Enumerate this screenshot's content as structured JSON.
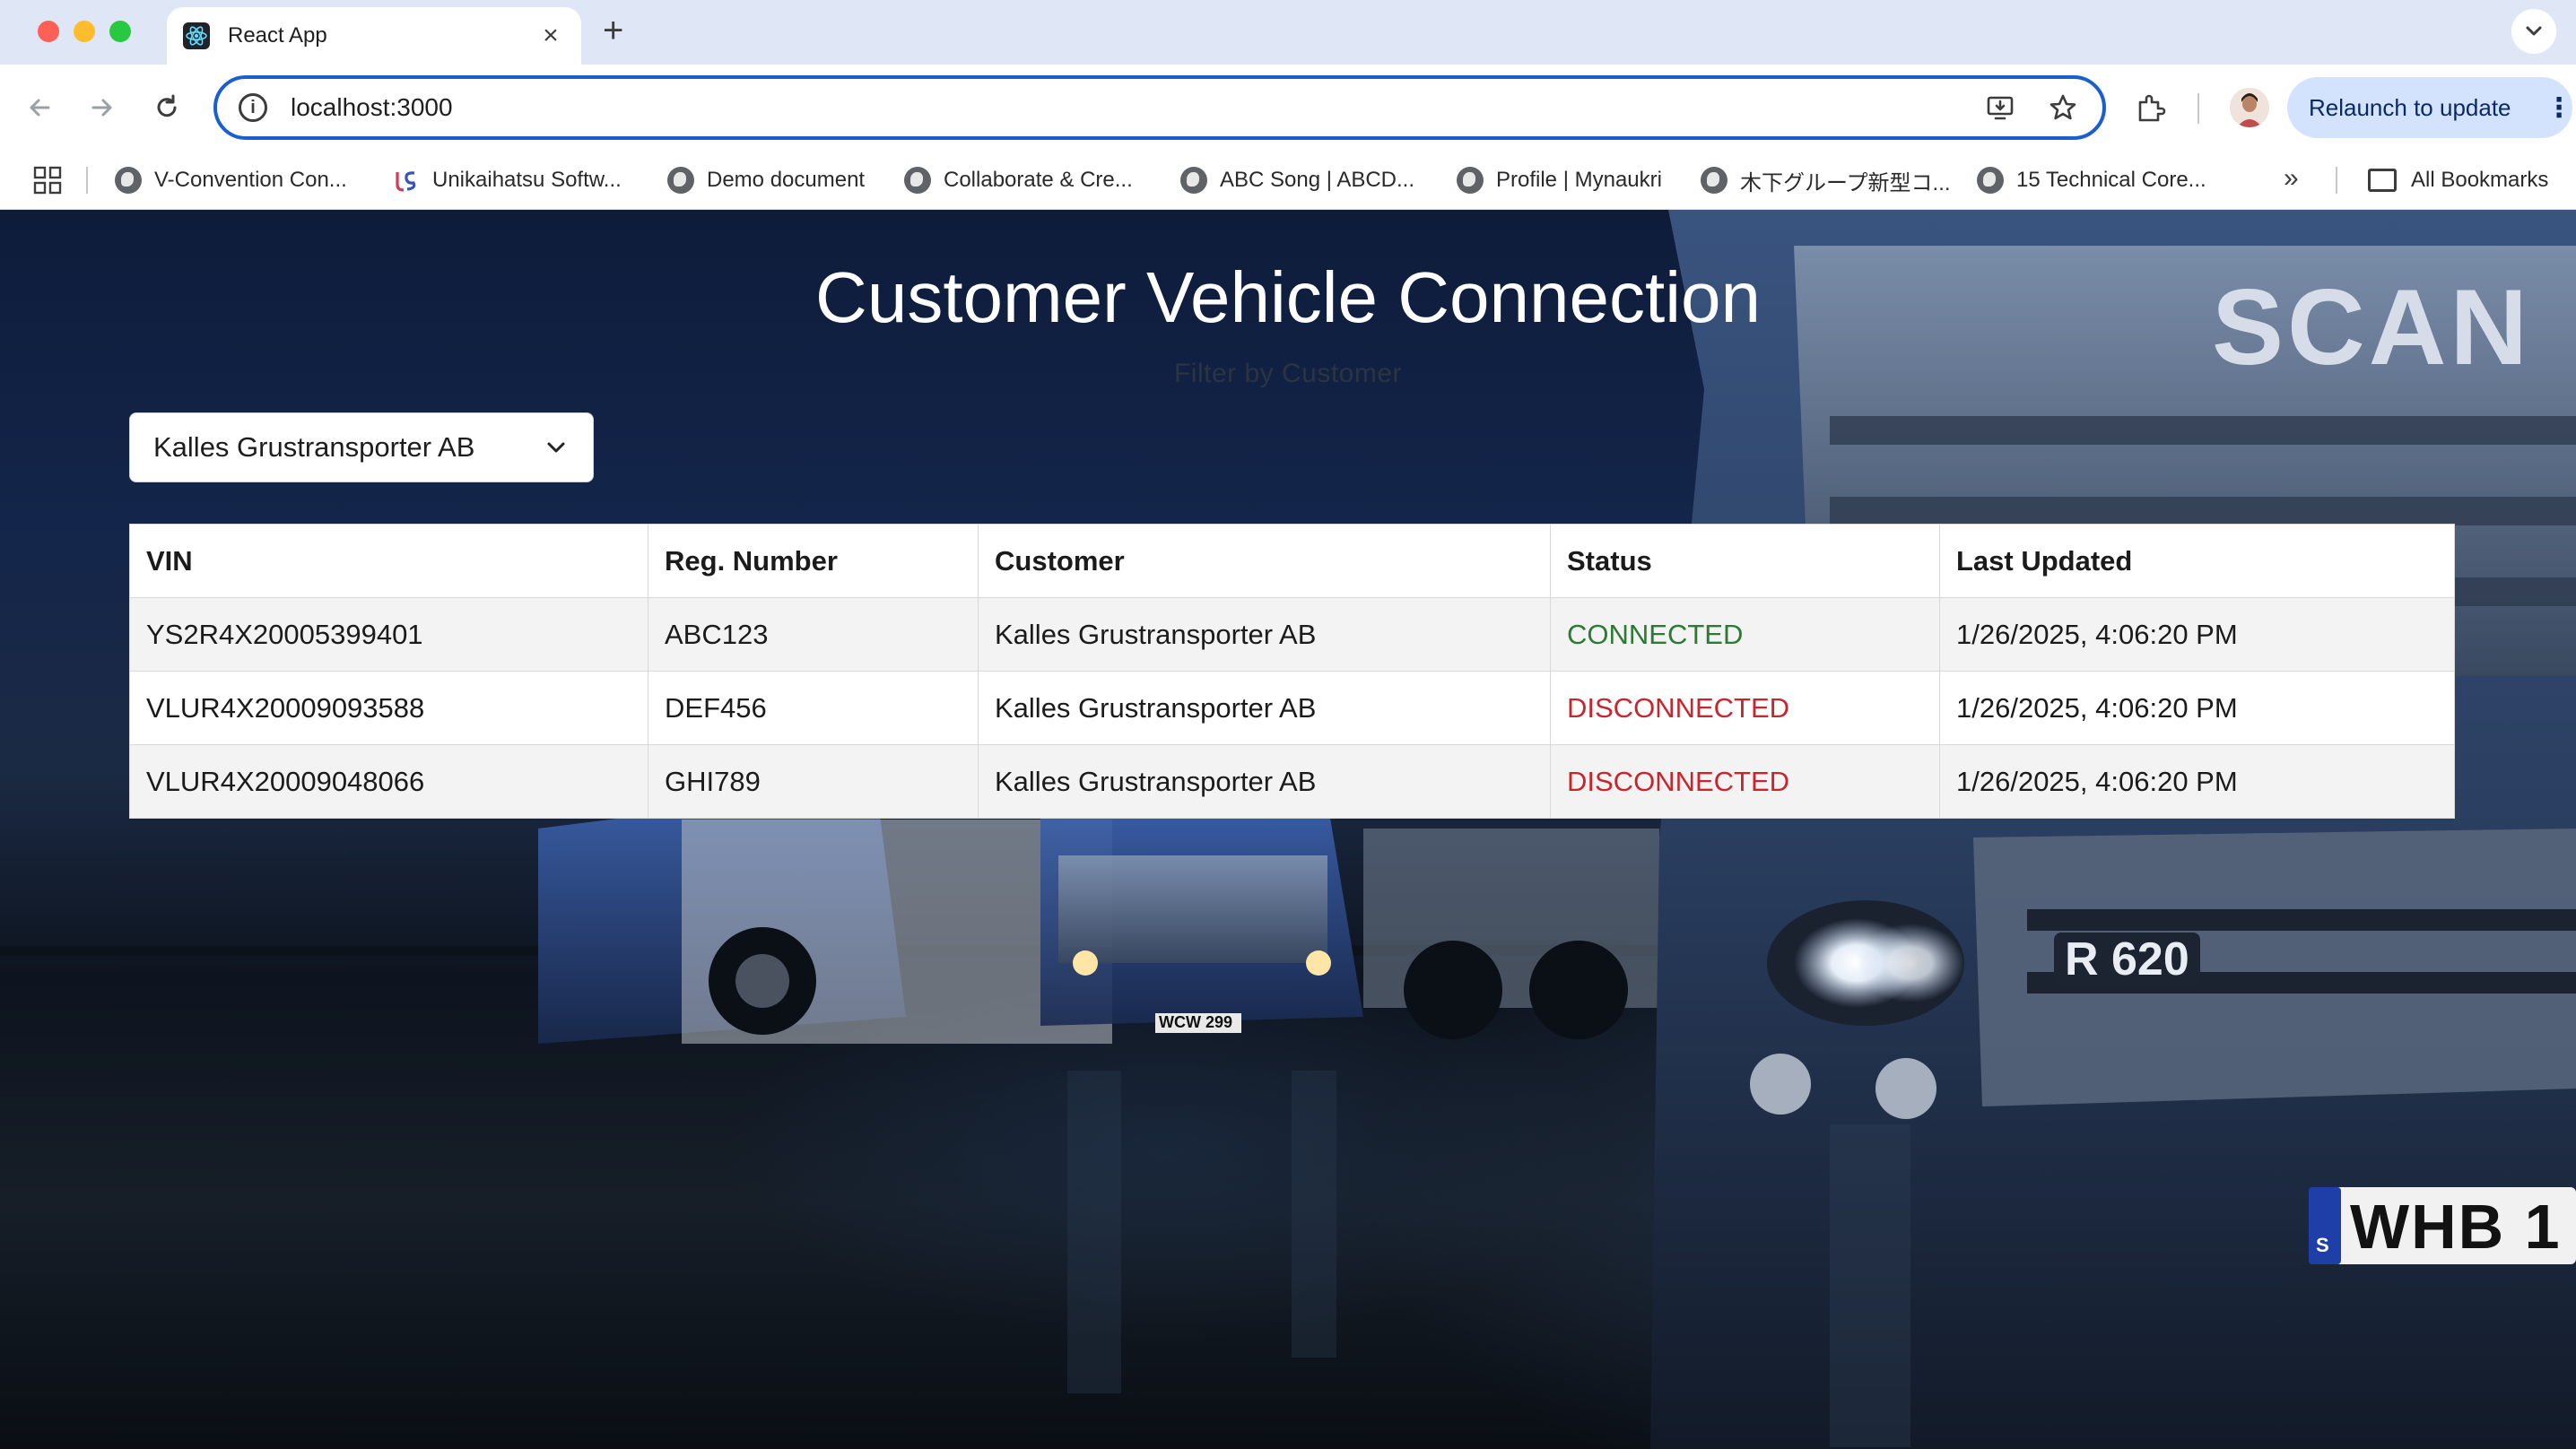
{
  "browser": {
    "tab": {
      "title": "React App"
    },
    "address_bar": {
      "url": "localhost:3000"
    },
    "relaunch_label": "Relaunch to update",
    "bookmarks": [
      {
        "label": "V-Convention Con...",
        "icon": "globe-icon"
      },
      {
        "label": "Unikaihatsu Softw...",
        "icon": "brand-icon"
      },
      {
        "label": "Demo document",
        "icon": "globe-icon"
      },
      {
        "label": "Collaborate & Cre...",
        "icon": "globe-icon"
      },
      {
        "label": "ABC Song | ABCD...",
        "icon": "globe-icon"
      },
      {
        "label": "Profile | Mynaukri",
        "icon": "globe-icon"
      },
      {
        "label": "木下グループ新型コ...",
        "icon": "globe-icon"
      },
      {
        "label": "15 Technical Core...",
        "icon": "globe-icon"
      }
    ],
    "all_bookmarks_label": "All Bookmarks",
    "overflow_glyph": "»"
  },
  "page": {
    "title": "Customer Vehicle Connection",
    "filter_label": "Filter by Customer",
    "customer_select": {
      "value": "Kalles Grustransporter AB"
    },
    "table": {
      "columns": [
        "VIN",
        "Reg. Number",
        "Customer",
        "Status",
        "Last Updated"
      ],
      "rows": [
        {
          "vin": "YS2R4X20005399401",
          "reg": "ABC123",
          "customer": "Kalles Grustransporter AB",
          "status": "CONNECTED",
          "updated": "1/26/2025, 4:06:20 PM"
        },
        {
          "vin": "VLUR4X20009093588",
          "reg": "DEF456",
          "customer": "Kalles Grustransporter AB",
          "status": "DISCONNECTED",
          "updated": "1/26/2025, 4:06:20 PM"
        },
        {
          "vin": "VLUR4X20009048066",
          "reg": "GHI789",
          "customer": "Kalles Grustransporter AB",
          "status": "DISCONNECTED",
          "updated": "1/26/2025, 4:06:20 PM"
        }
      ]
    },
    "background_lettering": {
      "brand": "SCAN",
      "model": "R 620",
      "plate_main": "WHB 1",
      "plate_small": "WCW 299",
      "plate_country": "S"
    }
  },
  "colors": {
    "connected": "#2c7a34",
    "disconnected": "#c8262f",
    "accent": "#1a5fd0"
  }
}
